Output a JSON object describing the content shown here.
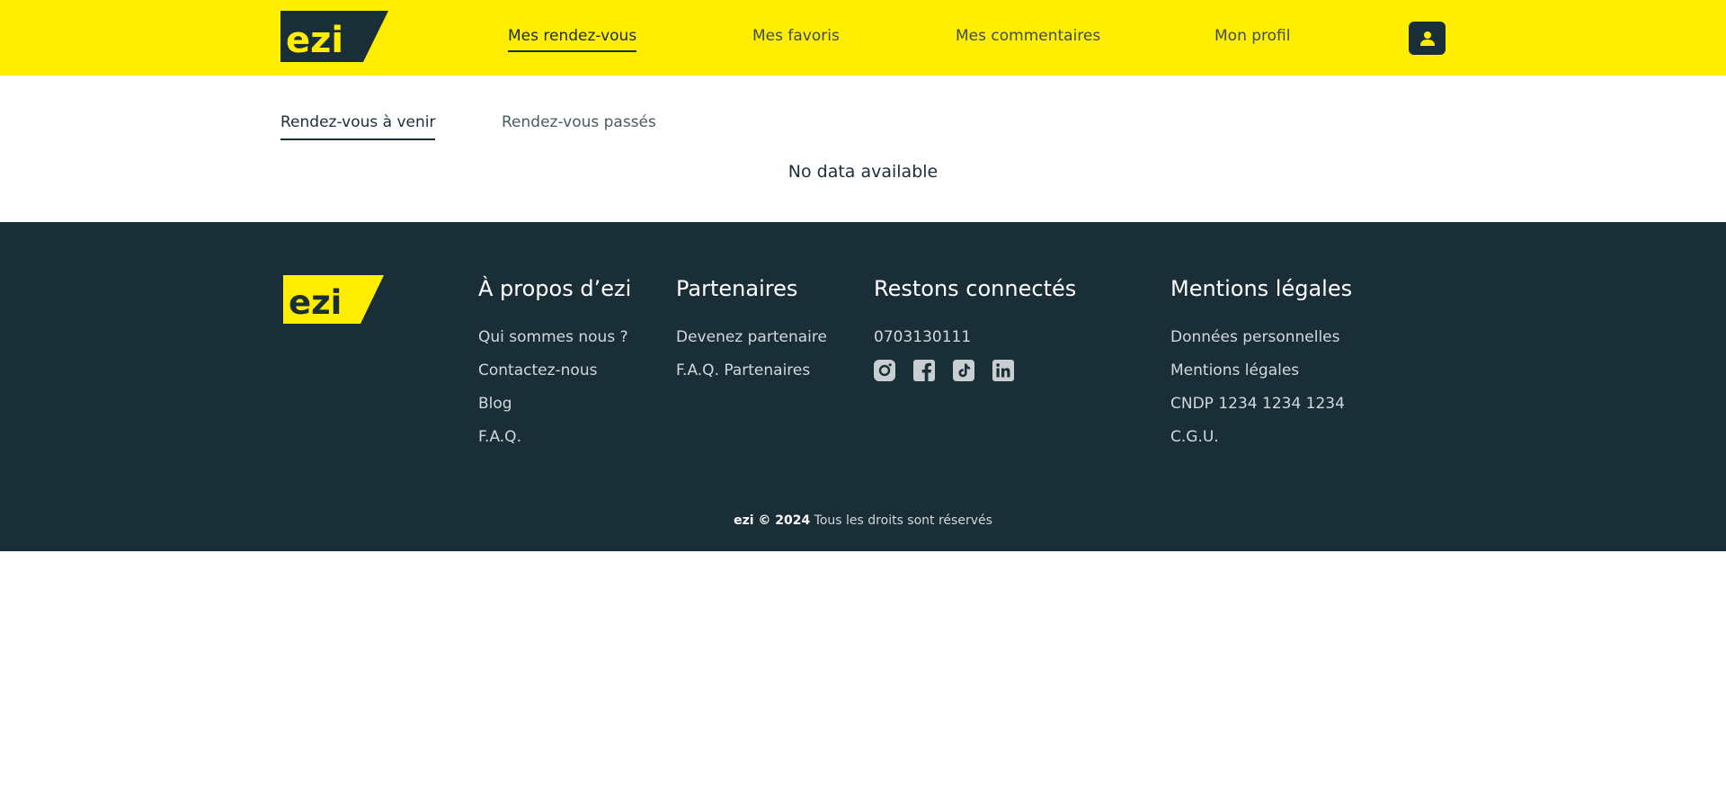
{
  "colors": {
    "brand_yellow": "#ffee00",
    "dark_navy": "#1a2e38",
    "white": "#ffffff"
  },
  "brand": {
    "logo_text": "ezi"
  },
  "header": {
    "nav": [
      {
        "label": "Mes rendez-vous",
        "active": true
      },
      {
        "label": "Mes favoris",
        "active": false
      },
      {
        "label": "Mes commentaires",
        "active": false
      },
      {
        "label": "Mon profil",
        "active": false
      }
    ],
    "profile_icon": "user-icon"
  },
  "main": {
    "tabs": [
      {
        "label": "Rendez-vous à venir",
        "active": true
      },
      {
        "label": "Rendez-vous passés",
        "active": false
      }
    ],
    "empty_message": "No data available"
  },
  "footer": {
    "columns": [
      {
        "title": "À propos d’ezi",
        "links": [
          "Qui sommes nous ?",
          "Contactez-nous",
          "Blog",
          "F.A.Q."
        ]
      },
      {
        "title": "Partenaires",
        "links": [
          "Devenez partenaire",
          "F.A.Q. Partenaires"
        ]
      },
      {
        "title": "Restons connectés",
        "phone": "0703130111",
        "social_icons": [
          "instagram-icon",
          "facebook-icon",
          "tiktok-icon",
          "linkedin-icon"
        ]
      },
      {
        "title": "Mentions légales",
        "links": [
          "Données personnelles",
          "Mentions légales",
          "CNDP 1234 1234 1234",
          "C.G.U."
        ]
      }
    ],
    "copyright_brand": "ezi © 2024",
    "copyright_text": " Tous les droits sont réservés"
  }
}
